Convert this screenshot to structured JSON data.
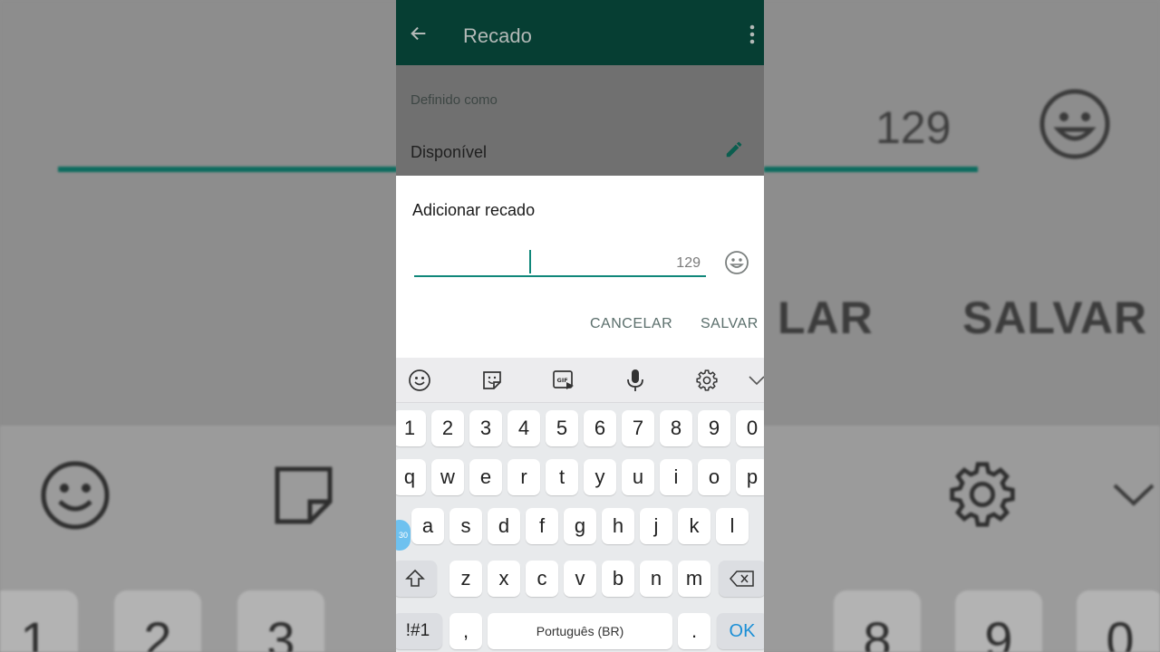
{
  "appbar": {
    "title": "Recado"
  },
  "status": {
    "section_label": "Definido como",
    "current": "Disponível"
  },
  "dialog": {
    "title": "Adicionar recado",
    "input_value": "",
    "remaining": "129",
    "cancel_label": "CANCELAR",
    "save_label": "SALVAR"
  },
  "background": {
    "count": "129",
    "action_partial": "LAR",
    "action_save": "SALVAR",
    "keys": [
      "1",
      "2",
      "3",
      "8",
      "9",
      "0"
    ]
  },
  "keyboard": {
    "toolbar": [
      "emoji-icon",
      "sticker-icon",
      "gif-icon",
      "microphone-icon",
      "settings-icon",
      "chevron-down-icon"
    ],
    "numbers": [
      "1",
      "2",
      "3",
      "4",
      "5",
      "6",
      "7",
      "8",
      "9",
      "0"
    ],
    "row1": [
      "q",
      "w",
      "e",
      "r",
      "t",
      "y",
      "u",
      "i",
      "o",
      "p"
    ],
    "row2": [
      "a",
      "s",
      "d",
      "f",
      "g",
      "h",
      "j",
      "k",
      "l"
    ],
    "row3": [
      "z",
      "x",
      "c",
      "v",
      "b",
      "n",
      "m"
    ],
    "symbols_label": "!#1",
    "comma": ",",
    "space_label": "Português (BR)",
    "period": ".",
    "ok_label": "OK",
    "bubble_text": "30"
  },
  "colors": {
    "appbar": "#063e33",
    "accent": "#10877a",
    "ok": "#1b8fd6"
  }
}
